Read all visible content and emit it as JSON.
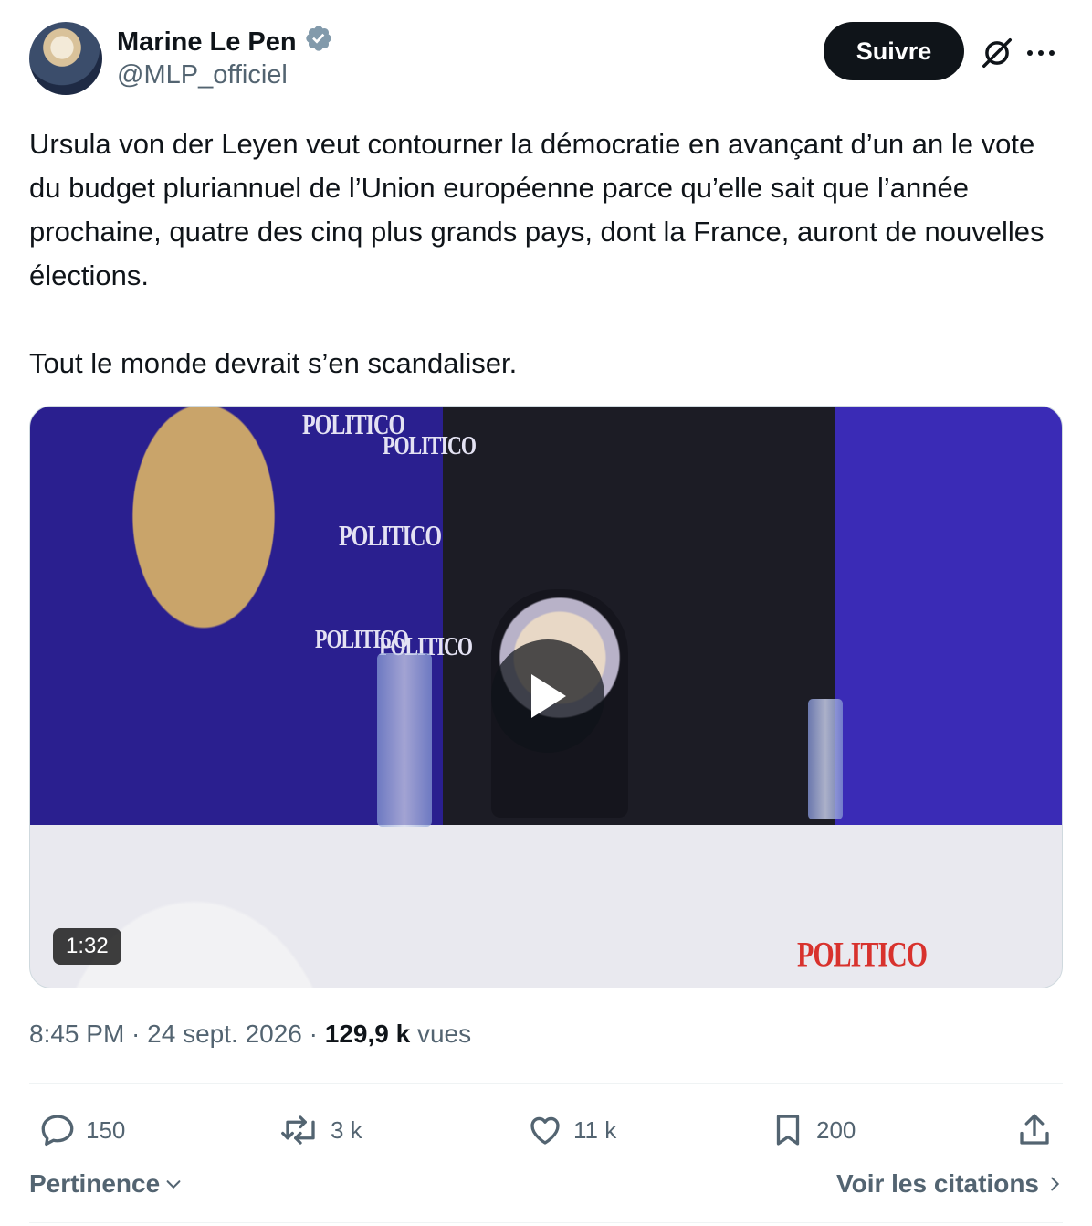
{
  "author": {
    "name": "Marine Le Pen",
    "handle": "@MLP_officiel",
    "verified_icon": "verified-badge-icon"
  },
  "header": {
    "follow_label": "Suivre",
    "grok_icon": "grok-icon",
    "more_icon": "more-icon"
  },
  "tweet": {
    "text": "Ursula von der Leyen veut contourner la démocratie en avançant d’un an le vote du budget pluriannuel de l’Union européenne parce qu’elle sait que l’année prochaine, quatre des cinq plus grands pays, dont la France, auront de nouvelles élections.\n\nTout le monde devrait s’en scandaliser."
  },
  "media": {
    "duration": "1:32",
    "logos": [
      "POLITICO",
      "POLITICO",
      "POLITICO",
      "POLITICO",
      "POLITICO",
      "POLITICO"
    ]
  },
  "meta": {
    "time": "8:45 PM",
    "sep1": " · ",
    "date": "24 sept. 2026",
    "sep2": " · ",
    "views_count": "129,9 k",
    "views_label": " vues"
  },
  "actions": {
    "replies": "150",
    "reposts": "3 k",
    "likes": "11 k",
    "bookmarks": "200"
  },
  "footer": {
    "sort_label": "Pertinence",
    "quotes_label": "Voir les citations"
  },
  "colors": {
    "text": "#0f1419",
    "secondary": "#536471",
    "border": "#cfd9de"
  }
}
